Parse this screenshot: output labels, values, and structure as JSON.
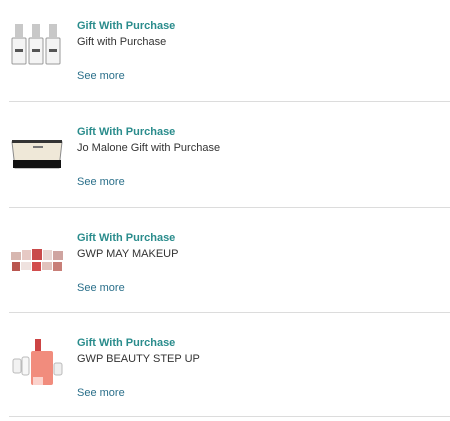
{
  "items": [
    {
      "title": "Gift With Purchase",
      "desc": "Gift with Purchase",
      "more": "See more",
      "icon": "perfume-bottles-icon"
    },
    {
      "title": "Gift With Purchase",
      "desc": "Jo Malone Gift with Purchase",
      "more": "See more",
      "icon": "cosmetic-pouch-icon"
    },
    {
      "title": "Gift With Purchase",
      "desc": "GWP MAY MAKEUP",
      "more": "See more",
      "icon": "makeup-set-icon"
    },
    {
      "title": "Gift With Purchase",
      "desc": "GWP BEAUTY STEP UP",
      "more": "See more",
      "icon": "beauty-products-icon"
    }
  ],
  "colors": {
    "title": "#2a8c8c",
    "link": "#2a6f8a",
    "divider": "#dcdcdc"
  }
}
